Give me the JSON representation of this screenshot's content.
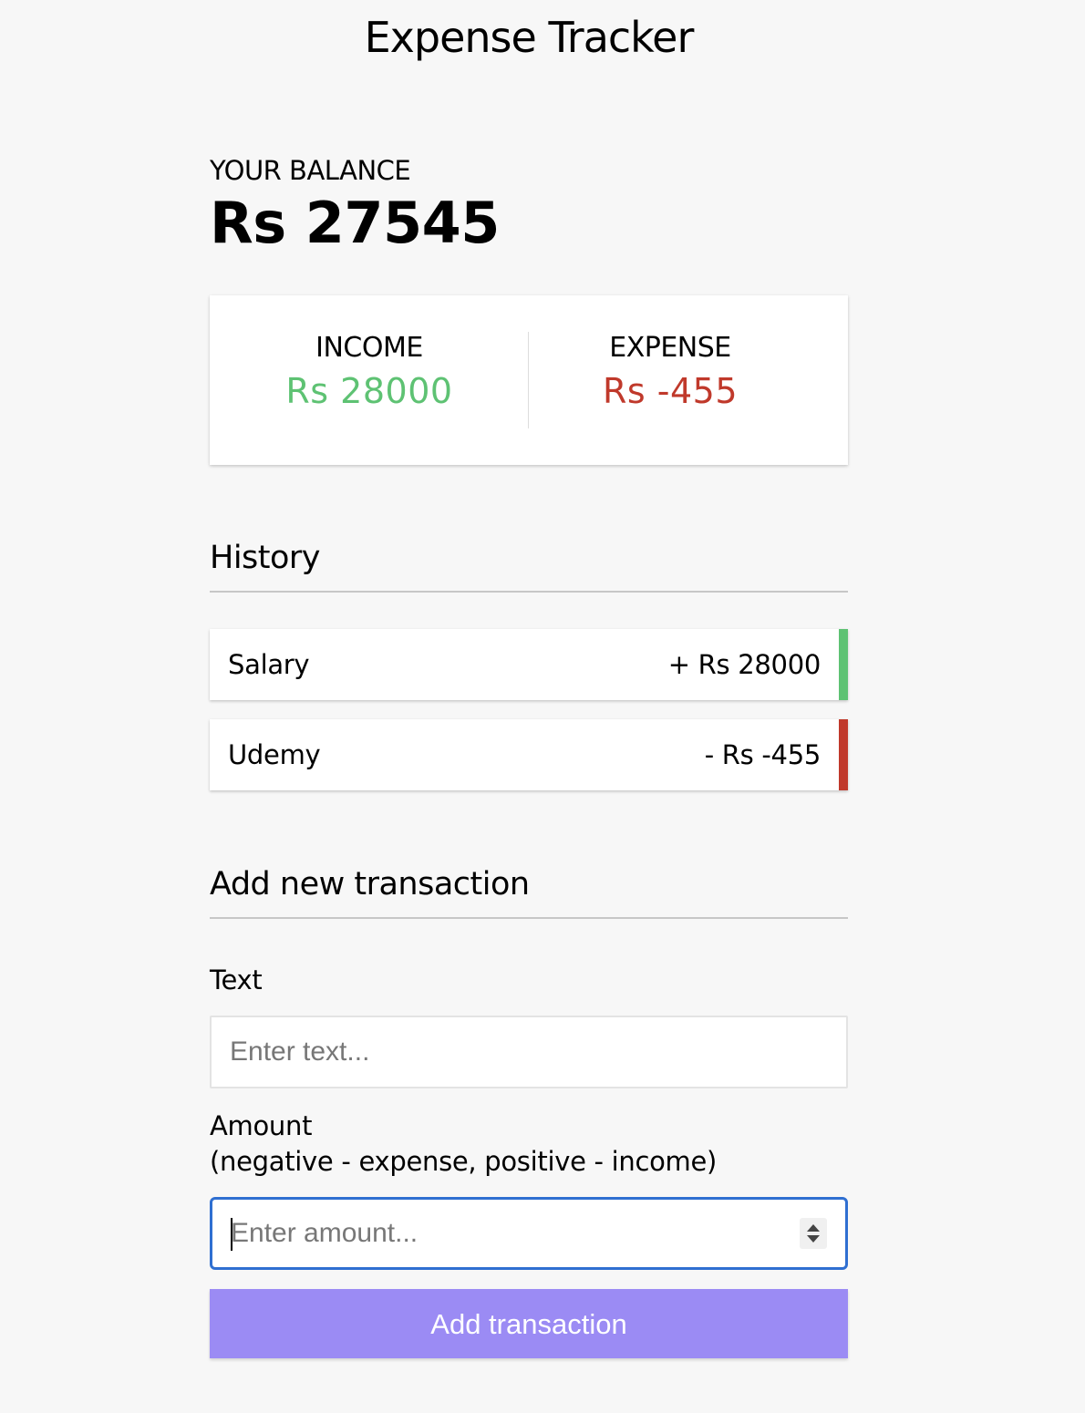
{
  "header": {
    "title": "Expense Tracker"
  },
  "balance": {
    "label": "YOUR BALANCE",
    "value": "Rs 27545"
  },
  "summary": {
    "income_label": "INCOME",
    "income_value": "Rs 28000",
    "expense_label": "EXPENSE",
    "expense_value": "Rs -455",
    "colors": {
      "income": "#5ec273",
      "expense": "#c0392b"
    }
  },
  "history": {
    "heading": "History",
    "items": [
      {
        "text": "Salary",
        "amount": "+ Rs 28000",
        "type": "income"
      },
      {
        "text": "Udemy",
        "amount": "- Rs -455",
        "type": "expense"
      }
    ]
  },
  "form": {
    "heading": "Add new transaction",
    "text_label": "Text",
    "text_placeholder": "Enter text...",
    "amount_label_line1": "Amount",
    "amount_label_line2": "(negative - expense, positive - income)",
    "amount_placeholder": "Enter amount...",
    "submit_label": "Add transaction",
    "accent_color": "#9b8bf4"
  }
}
